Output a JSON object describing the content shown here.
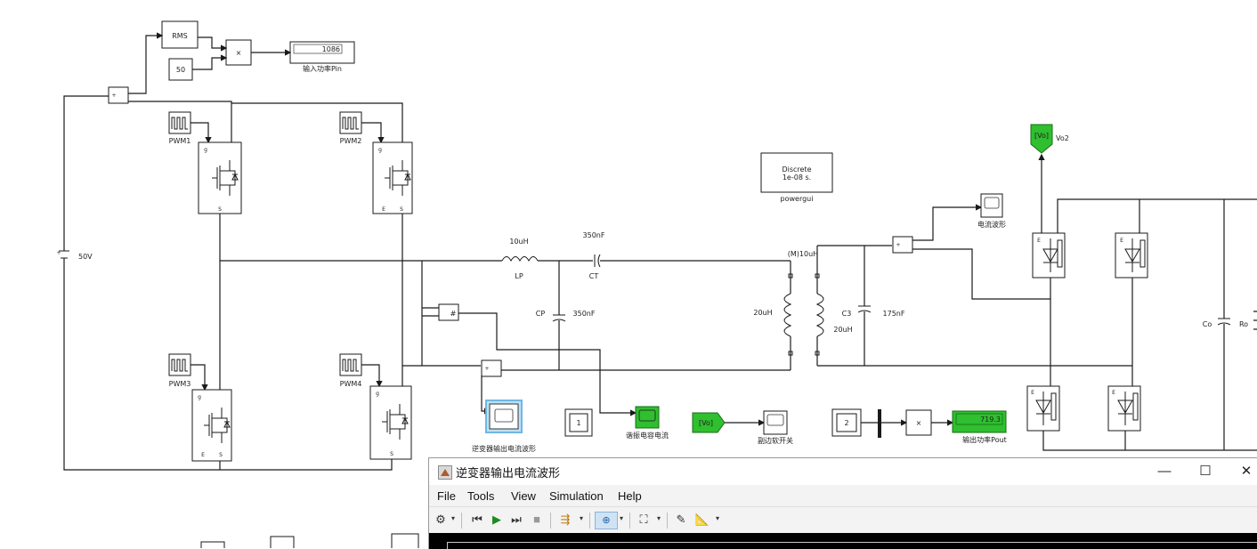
{
  "model": {
    "rms_label": "RMS",
    "const_50": "50",
    "multiply_symbol": "×",
    "sum_symbol": "+",
    "input_power_display": "1086",
    "input_power_label": "输入功率Pin",
    "dc_source_label": "50V",
    "pwm_labels": [
      "PWM1",
      "PWM2",
      "PWM3",
      "PWM4"
    ],
    "mosfet_terminals": {
      "gate": "g",
      "emitter": "E",
      "source": "S"
    },
    "lp_value": "10uH",
    "lp_name": "LP",
    "ct_value": "350nF",
    "ct_name": "CT",
    "cp_name": "CP",
    "cp_value": "350nF",
    "powergui_line1": "Discrete",
    "powergui_line2": "1e-08 s.",
    "powergui_label": "powergui",
    "mutual_label": "(M)10uH",
    "primary_inductance": "20uH",
    "secondary_inductance": "20uH",
    "c3_name": "C3",
    "c3_value": "175nF",
    "vo2_tag": "[Vo]",
    "vo2_label": "Vo2",
    "current_scope_label": "电流波形",
    "inverter_scope_label": "逆变器输出电流波形",
    "resonant_scope_label": "谐振电容电流",
    "soft_switch_scope_label": "副边软开关",
    "const_1": "1",
    "const_2": "2",
    "output_power_display": "719.3",
    "output_power_label": "输出功率Pout",
    "vo_from_tag": "[Vo]",
    "co_label": "Co",
    "ro_label": "Ro",
    "product_symbol": "#",
    "colors": {
      "display_green": "#2fbf2f",
      "scope_highlight": "#6fb7e6"
    }
  },
  "scope_window": {
    "title": "逆变器输出电流波形",
    "window_buttons": {
      "minimize": "—",
      "maximize": "☐",
      "close": "✕"
    },
    "menu": [
      "File",
      "Tools",
      "View",
      "Simulation",
      "Help"
    ],
    "toolbar_icons": [
      "gear-icon",
      "step-back-icon",
      "run-icon",
      "step-forward-icon",
      "stop-icon",
      "signal-select-icon",
      "zoom-icon",
      "fit-icon",
      "style-icon",
      "measure-icon"
    ]
  }
}
